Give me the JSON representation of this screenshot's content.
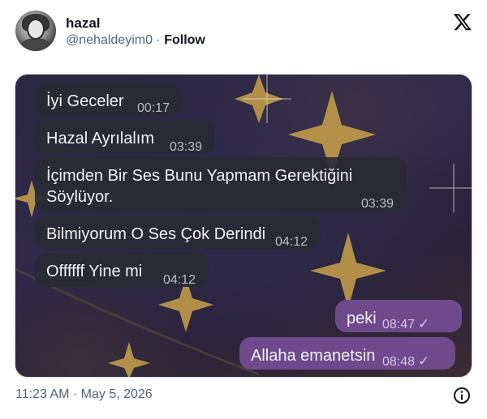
{
  "tweet": {
    "display_name": "hazal",
    "handle": "@nehaldeyim0",
    "separator": "·",
    "follow_label": "Follow",
    "timestamp": "11:23 AM · May 5, 2026"
  },
  "chat": {
    "messages": [
      {
        "text": "İyi Geceler",
        "time": "00:17",
        "direction": "incoming"
      },
      {
        "text": "Hazal Ayrılalım",
        "time": "03:39",
        "direction": "incoming"
      },
      {
        "text": "İçimden Bir Ses Bunu Yapmam Gerektiğini\nSöylüyor.",
        "time": "03:39",
        "direction": "incoming"
      },
      {
        "text": "Bilmiyorum O Ses Çok Derindi",
        "time": "04:12",
        "direction": "incoming"
      },
      {
        "text": "Offffff Yine mi",
        "time": "04:12",
        "direction": "incoming"
      },
      {
        "text": "peki",
        "time": "08:47",
        "direction": "outgoing",
        "status": "✓"
      },
      {
        "text": "Allaha emanetsin",
        "time": "08:48",
        "direction": "outgoing",
        "status": "✓"
      }
    ]
  },
  "icons": {
    "logo": "x-logo-icon",
    "info": "info-icon",
    "read_receipt": "check-icon"
  },
  "colors": {
    "incoming_bubble": "#282a34",
    "outgoing_bubble": "#6e4a8c",
    "handle_gray": "#536471",
    "star_gold": "#c9a24a"
  }
}
